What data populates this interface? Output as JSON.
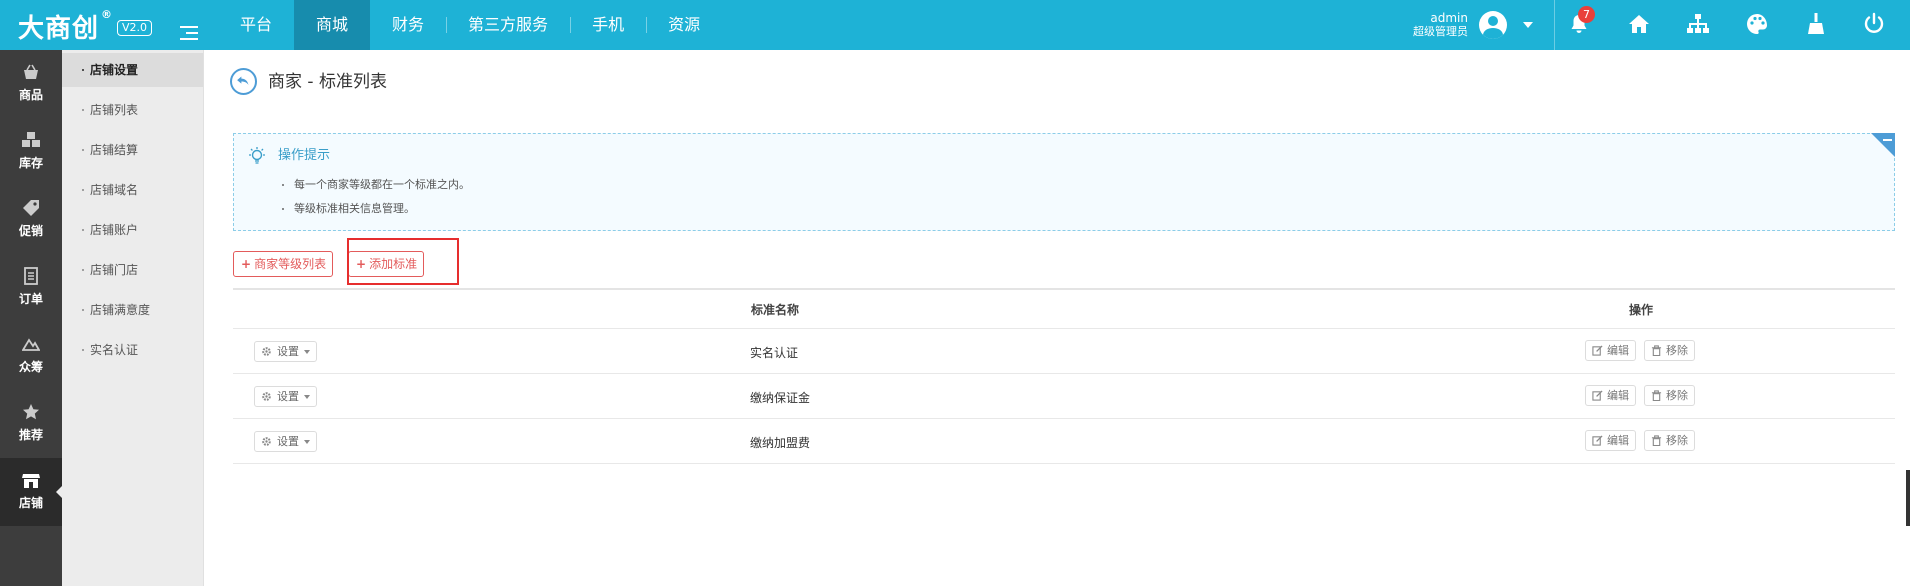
{
  "header": {
    "logo_text": "大商创",
    "logo_reg": "®",
    "version": "V2.0",
    "nav": [
      "平台",
      "商城",
      "财务",
      "第三方服务",
      "手机",
      "资源"
    ],
    "active_nav": "商城",
    "user": {
      "name": "admin",
      "role": "超级管理员"
    },
    "notification_count": "7",
    "icons": [
      "bell-icon",
      "home-icon",
      "sitemap-icon",
      "palette-icon",
      "broom-icon",
      "power-icon"
    ]
  },
  "sidebar": {
    "items": [
      "商品",
      "库存",
      "促销",
      "订单",
      "众筹",
      "推荐",
      "店铺"
    ],
    "active": "店铺"
  },
  "submenu": {
    "items": [
      "店铺设置",
      "店铺列表",
      "店铺结算",
      "店铺域名",
      "店铺账户",
      "店铺门店",
      "店铺满意度",
      "实名认证"
    ],
    "active": "店铺设置"
  },
  "page": {
    "title": "商家 - 标准列表",
    "tips": {
      "title": "操作提示",
      "lines": [
        "每一个商家等级都在一个标准之内。",
        "等级标准相关信息管理。"
      ]
    },
    "buttons": {
      "grade_list": "商家等级列表",
      "add_standard": "添加标准"
    },
    "table": {
      "headers": {
        "name": "标准名称",
        "ops": "操作"
      },
      "rows": [
        {
          "setting": "设置",
          "name": "实名认证",
          "edit": "编辑",
          "remove": "移除"
        },
        {
          "setting": "设置",
          "name": "缴纳保证金",
          "edit": "编辑",
          "remove": "移除"
        },
        {
          "setting": "设置",
          "name": "缴纳加盟费",
          "edit": "编辑",
          "remove": "移除"
        }
      ]
    }
  },
  "colors": {
    "header_bg": "#1eb2d6",
    "nav_active": "#178cad",
    "accent_red": "#e35b5b",
    "sidebar_bg": "#3d3d3d"
  }
}
